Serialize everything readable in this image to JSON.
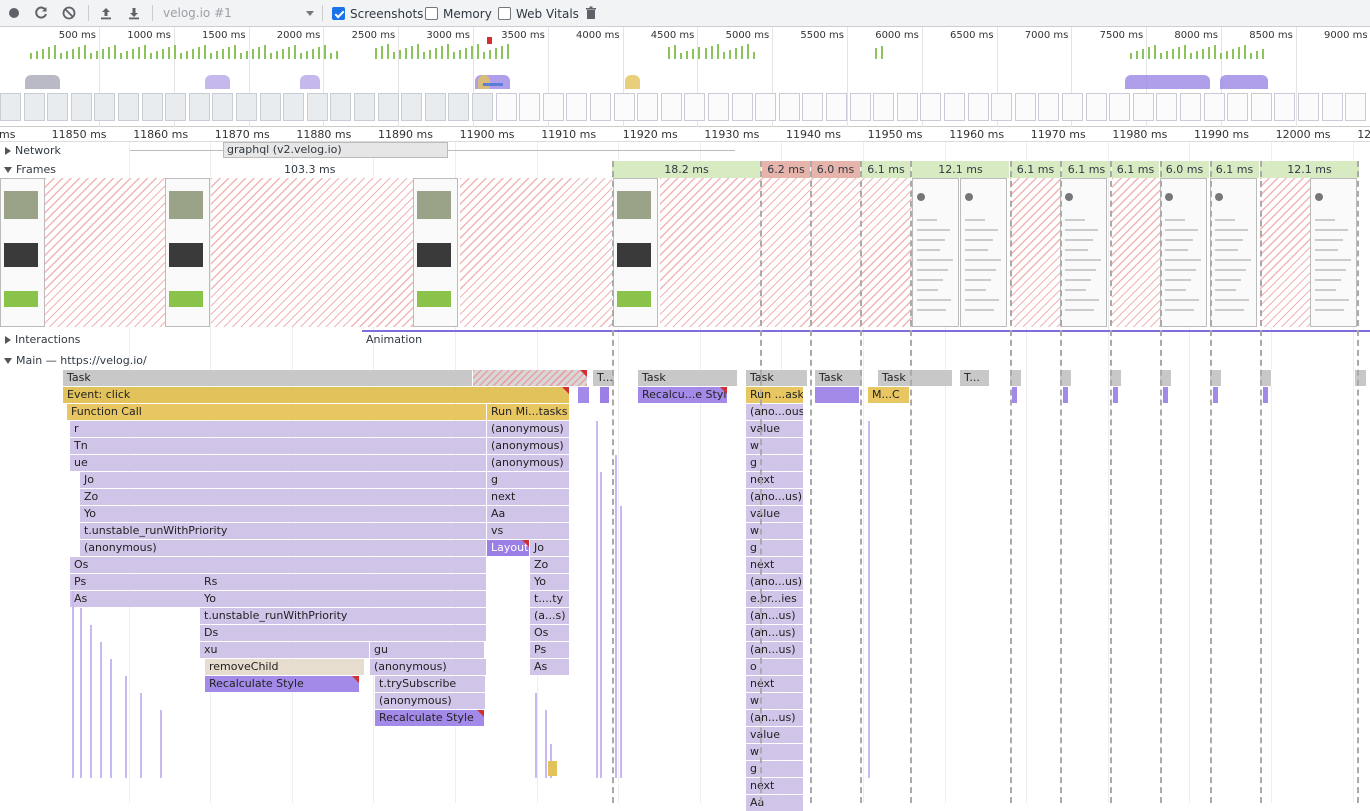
{
  "toolbar": {
    "profile_select": "velog.io #1",
    "screenshots_label": "Screenshots",
    "screenshots_checked": true,
    "memory_label": "Memory",
    "memory_checked": false,
    "webvitals_label": "Web Vitals",
    "webvitals_checked": false,
    "icons": [
      "record-icon",
      "reload-icon",
      "clear-icon",
      "upload-icon",
      "download-icon",
      "trash-icon"
    ]
  },
  "overview": {
    "ticks": [
      "500 ms",
      "1000 ms",
      "1500 ms",
      "2000 ms",
      "2500 ms",
      "3000 ms",
      "3500 ms",
      "4000 ms",
      "4500 ms",
      "5000 ms",
      "5500 ms",
      "6000 ms",
      "6500 ms",
      "7000 ms",
      "7500 ms",
      "8000 ms",
      "8500 ms",
      "9000 ms"
    ]
  },
  "ruler": {
    "ticks": [
      "ms",
      "11850 ms",
      "11860 ms",
      "11870 ms",
      "11880 ms",
      "11890 ms",
      "11900 ms",
      "11910 ms",
      "11920 ms",
      "11930 ms",
      "11940 ms",
      "11950 ms",
      "11960 ms",
      "11970 ms",
      "11980 ms",
      "11990 ms",
      "12000 ms",
      "12"
    ]
  },
  "tracks": {
    "network": "Network",
    "network_request": "graphql (v2.velog.io)",
    "frames": "Frames",
    "frames_duration": "103.3 ms",
    "frame_times": [
      "18.2 ms",
      "6.2 ms",
      "6.0 ms",
      "6.1 ms",
      "12.1 ms",
      "6.1 ms",
      "6.1 ms",
      "6.1 ms",
      "6.0 ms",
      "6.1 ms",
      "12.1 ms"
    ],
    "interactions": "Interactions",
    "animation": "Animation",
    "main": "Main — https://velog.io/"
  },
  "flame": {
    "task": "Task",
    "task_short": "T...",
    "event_click": "Event: click",
    "function_call": "Function Call",
    "run_microtasks": "Run Mi...tasks",
    "run_asks": "Run ...asks",
    "recalc_short": "Recalcu...e Style",
    "mc": "M...C",
    "col_a": [
      "r",
      "Tn",
      "ue",
      "Jo",
      "Zo",
      "Yo",
      "t.unstable_runWithPriority",
      "(anonymous)",
      "Os",
      "Ps",
      "As"
    ],
    "col_b": [
      "Rs",
      "Yo",
      "t.unstable_runWithPriority",
      "Ds",
      "xu"
    ],
    "remove_child": "removeChild",
    "recalc_style": "Recalculate Style",
    "col_c": [
      "gu",
      "(anonymous)",
      "t.trySubscribe",
      "(anonymous)"
    ],
    "col_d": [
      "(anonymous)",
      "(anonymous)",
      "(anonymous)",
      "g",
      "next",
      "Aa",
      "vs"
    ],
    "layout": "Layout",
    "col_e": [
      "Jo",
      "Zo",
      "Yo",
      "t....ty",
      "(a...s)",
      "Os",
      "Ps",
      "As"
    ],
    "col_f": [
      "(ano...ous)",
      "value",
      "w",
      "g",
      "next",
      "(ano...us)",
      "value",
      "w",
      "g",
      "next",
      "(ano...us)",
      "e.br...ies",
      "(an...us)",
      "(an...us)",
      "(an...us)",
      "o",
      "next",
      "w",
      "(an...us)",
      "value",
      "w",
      "g",
      "next",
      "Aa"
    ]
  }
}
